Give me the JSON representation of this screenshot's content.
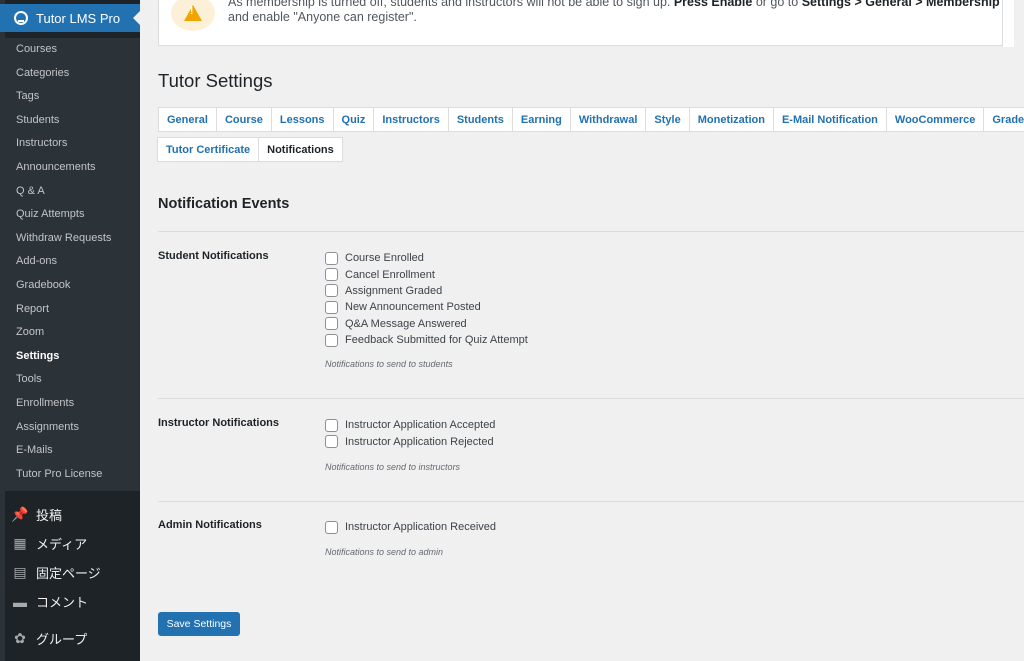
{
  "sidebar": {
    "plugin_title": "Tutor LMS Pro",
    "submenu": [
      {
        "label": "Courses",
        "current": false
      },
      {
        "label": "Categories",
        "current": false
      },
      {
        "label": "Tags",
        "current": false
      },
      {
        "label": "Students",
        "current": false
      },
      {
        "label": "Instructors",
        "current": false
      },
      {
        "label": "Announcements",
        "current": false
      },
      {
        "label": "Q & A",
        "current": false
      },
      {
        "label": "Quiz Attempts",
        "current": false
      },
      {
        "label": "Withdraw Requests",
        "current": false
      },
      {
        "label": "Add-ons",
        "current": false
      },
      {
        "label": "Gradebook",
        "current": false
      },
      {
        "label": "Report",
        "current": false
      },
      {
        "label": "Zoom",
        "current": false
      },
      {
        "label": "Settings",
        "current": true
      },
      {
        "label": "Tools",
        "current": false
      },
      {
        "label": "Enrollments",
        "current": false
      },
      {
        "label": "Assignments",
        "current": false
      },
      {
        "label": "E-Mails",
        "current": false
      },
      {
        "label": "Tutor Pro License",
        "current": false
      }
    ],
    "main_menu": [
      {
        "label": "投稿",
        "icon": "pin-icon"
      },
      {
        "label": "メディア",
        "icon": "media-icon"
      },
      {
        "label": "固定ページ",
        "icon": "pages-icon"
      },
      {
        "label": "コメント",
        "icon": "comment-icon"
      },
      {
        "label": "グループ",
        "icon": "group-icon"
      }
    ]
  },
  "notice": {
    "line1_prefix": "As membership is turned off, students and instructors will not be able to sign up. ",
    "line1_bold1": "Press Enable",
    "line1_mid": " or go to ",
    "line1_bold2": "Settings > General > Membership",
    "line2": "and enable \"Anyone can register\"."
  },
  "page_title": "Tutor Settings",
  "tabs_row1": [
    "General",
    "Course",
    "Lessons",
    "Quiz",
    "Instructors",
    "Students",
    "Earning",
    "Withdrawal",
    "Style",
    "Monetization",
    "E-Mail Notification",
    "WooCommerce",
    "Gradebook"
  ],
  "tabs_row2": [
    "Tutor Certificate",
    "Notifications"
  ],
  "active_tab": "Notifications",
  "section_title": "Notification Events",
  "groups": {
    "student": {
      "label": "Student Notifications",
      "options": [
        "Course Enrolled",
        "Cancel Enrollment",
        "Assignment Graded",
        "New Announcement Posted",
        "Q&A Message Answered",
        "Feedback Submitted for Quiz Attempt"
      ],
      "description": "Notifications to send to students"
    },
    "instructor": {
      "label": "Instructor Notifications",
      "options": [
        "Instructor Application Accepted",
        "Instructor Application Rejected"
      ],
      "description": "Notifications to send to instructors"
    },
    "admin": {
      "label": "Admin Notifications",
      "options": [
        "Instructor Application Received"
      ],
      "description": "Notifications to send to admin"
    }
  },
  "save_label": "Save Settings",
  "colors": {
    "sidebar_bg": "#1d2327",
    "submenu_bg": "#2c3338",
    "accent": "#2271b1",
    "page_bg": "#f0f0f1",
    "warning": "#f0a500"
  }
}
